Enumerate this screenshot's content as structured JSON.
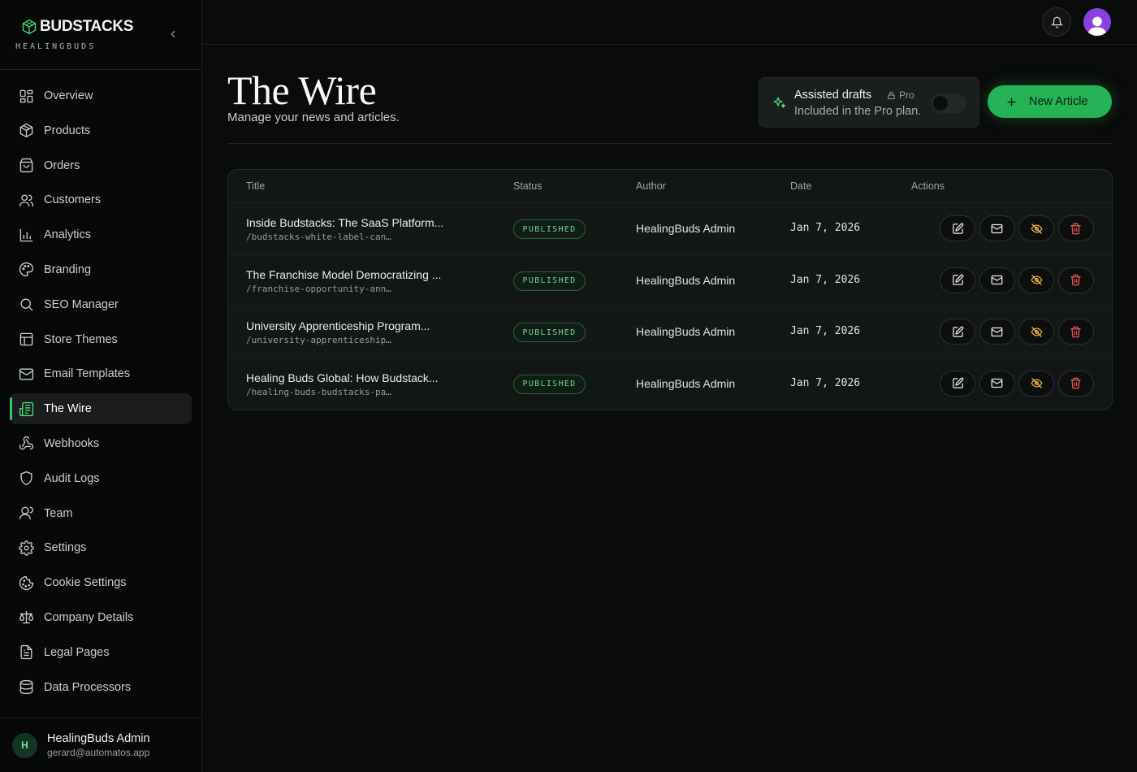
{
  "brand": {
    "name": "BUDSTACKS",
    "sub": "HEALINGBUDS"
  },
  "sidebar": {
    "items": [
      {
        "label": "Overview",
        "icon": "grid-icon"
      },
      {
        "label": "Products",
        "icon": "box-icon"
      },
      {
        "label": "Orders",
        "icon": "bag-icon"
      },
      {
        "label": "Customers",
        "icon": "users-icon"
      },
      {
        "label": "Analytics",
        "icon": "chart-icon"
      },
      {
        "label": "Branding",
        "icon": "palette-icon"
      },
      {
        "label": "SEO Manager",
        "icon": "search-icon"
      },
      {
        "label": "Store Themes",
        "icon": "layout-icon"
      },
      {
        "label": "Email Templates",
        "icon": "mail-icon"
      },
      {
        "label": "The Wire",
        "icon": "newspaper-icon",
        "active": true
      },
      {
        "label": "Webhooks",
        "icon": "webhook-icon"
      },
      {
        "label": "Audit Logs",
        "icon": "shield-icon"
      },
      {
        "label": "Team",
        "icon": "user-icon"
      },
      {
        "label": "Settings",
        "icon": "gear-icon"
      },
      {
        "label": "Cookie Settings",
        "icon": "cookie-icon"
      },
      {
        "label": "Company Details",
        "icon": "scale-icon"
      },
      {
        "label": "Legal Pages",
        "icon": "file-text-icon"
      },
      {
        "label": "Data Processors",
        "icon": "database-icon"
      }
    ]
  },
  "user": {
    "initial": "H",
    "name": "HealingBuds Admin",
    "email": "gerard@automatos.app"
  },
  "page": {
    "title": "The Wire",
    "subtitle": "Manage your news and articles."
  },
  "drafts": {
    "title": "Assisted drafts",
    "badge": "Pro",
    "subtitle": "Included in the Pro plan.",
    "enabled": false
  },
  "new_button": "New Article",
  "table": {
    "headers": {
      "title": "Title",
      "status": "Status",
      "author": "Author",
      "date": "Date",
      "actions": "Actions"
    },
    "rows": [
      {
        "title": "Inside Budstacks: The SaaS Platform...",
        "slug": "/budstacks-white-label-can…",
        "status": "PUBLISHED",
        "author": "HealingBuds Admin",
        "date": "Jan 7, 2026"
      },
      {
        "title": "The Franchise Model Democratizing ...",
        "slug": "/franchise-opportunity-ann…",
        "status": "PUBLISHED",
        "author": "HealingBuds Admin",
        "date": "Jan 7, 2026"
      },
      {
        "title": "University Apprenticeship Program...",
        "slug": "/university-apprenticeship…",
        "status": "PUBLISHED",
        "author": "HealingBuds Admin",
        "date": "Jan 7, 2026"
      },
      {
        "title": "Healing Buds Global: How Budstack...",
        "slug": "/healing-buds-budstacks-pa…",
        "status": "PUBLISHED",
        "author": "HealingBuds Admin",
        "date": "Jan 7, 2026"
      }
    ]
  },
  "colors": {
    "accent": "#25b355",
    "badge_text": "#6ed894",
    "hide": "#f0b34a",
    "delete": "#ef5a5a",
    "avatar": "#8b3fe0"
  }
}
